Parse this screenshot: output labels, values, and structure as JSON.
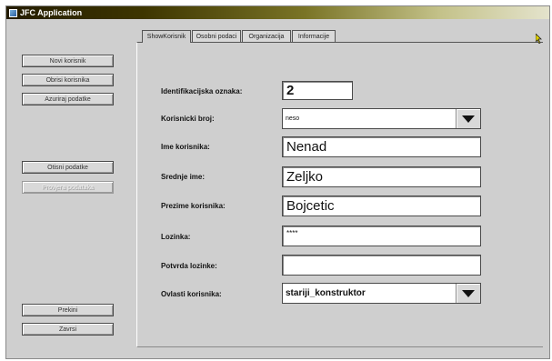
{
  "window": {
    "title": "JFC Application"
  },
  "sidebar": {
    "buttons": [
      "Novi korisnik",
      "Obrisi korisnika",
      "Azuriraj podatke",
      "Otisni podatke",
      "Provjera podataka",
      "Prekini",
      "Zavrsi"
    ]
  },
  "tabs": [
    "ShowKorisnik",
    "Osobni podaci",
    "Organizacija",
    "Informacije"
  ],
  "form": {
    "id_label": "Identifikacijska oznaka:",
    "id_value": "2",
    "broj_label": "Korisnicki broj:",
    "broj_value": "neso",
    "ime_label": "Ime korisnika:",
    "ime_value": "Nenad",
    "srednje_label": "Srednje ime:",
    "srednje_value": "Zeljko",
    "prezime_label": "Prezime korisnika:",
    "prezime_value": "Bojcetic",
    "lozinka_label": "Lozinka:",
    "lozinka_value": "****",
    "potvrda_label": "Potvrda lozinke:",
    "potvrda_value": "",
    "ovlasti_label": "Ovlasti korisnika:",
    "ovlasti_value": "stariji_konstruktor"
  }
}
